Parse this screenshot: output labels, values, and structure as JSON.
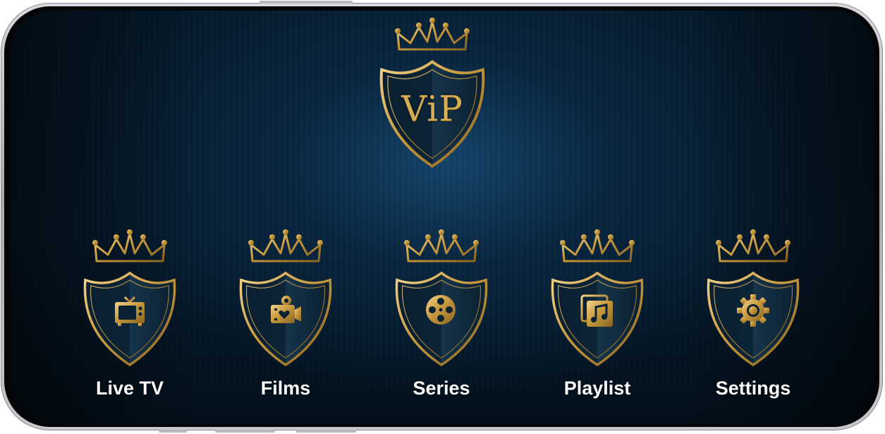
{
  "logo": {
    "text": "ViP"
  },
  "menu": [
    {
      "label": "Live TV",
      "icon": "tv-icon"
    },
    {
      "label": "Films",
      "icon": "camera-icon"
    },
    {
      "label": "Series",
      "icon": "film-reel-icon"
    },
    {
      "label": "Playlist",
      "icon": "music-playlist-icon"
    },
    {
      "label": "Settings",
      "icon": "gear-icon"
    }
  ],
  "colors": {
    "gold": "#d8ae55",
    "gold_dark": "#8a6420",
    "background": "#071d30",
    "label": "#ffffff"
  }
}
